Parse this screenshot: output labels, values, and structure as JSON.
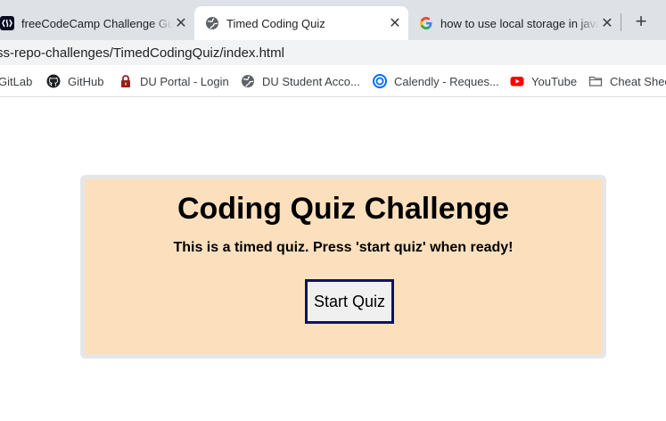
{
  "tabs": [
    {
      "title": "freeCodeCamp Challenge Guide",
      "icon": "freecodecamp-icon"
    },
    {
      "title": "Timed Coding Quiz",
      "icon": "globe-icon",
      "active": true
    },
    {
      "title": "how to use local storage in javascript",
      "icon": "google-icon"
    }
  ],
  "address": {
    "url": "ss-repo-challenges/TimedCodingQuiz/index.html"
  },
  "bookmarks": [
    {
      "label": "GitLab",
      "icon": "gitlab-icon"
    },
    {
      "label": "GitHub",
      "icon": "github-icon"
    },
    {
      "label": "DU Portal - Login",
      "icon": "du-lock-icon"
    },
    {
      "label": "DU Student Acco...",
      "icon": "globe-icon"
    },
    {
      "label": "Calendly - Reques...",
      "icon": "calendly-icon"
    },
    {
      "label": "YouTube",
      "icon": "youtube-icon"
    },
    {
      "label": "Cheat Shee",
      "icon": "folder-icon"
    }
  ],
  "quiz": {
    "title": "Coding Quiz Challenge",
    "subtitle": "This is a timed quiz. Press 'start quiz' when ready!",
    "start_label": "Start Quiz"
  },
  "colors": {
    "card_bg": "#fce0bd",
    "card_border": "#e6e6e6",
    "button_border": "#10106b",
    "tabstrip_bg": "#dee1e6"
  }
}
